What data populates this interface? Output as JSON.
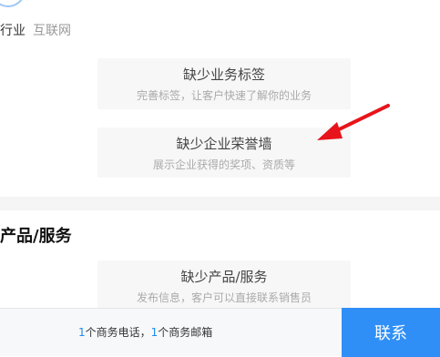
{
  "company": {
    "industry_label": "行业",
    "industry_value": "互联网"
  },
  "empty_states": {
    "tags": {
      "title": "缺少业务标签",
      "subtitle": "完善标签，让客户快速了解你的业务"
    },
    "honor": {
      "title": "缺少企业荣誉墙",
      "subtitle": "展示企业获得的奖项、资质等"
    },
    "product": {
      "title": "缺少产品/服务",
      "subtitle": "发布信息，客户可以直接联系销售员"
    }
  },
  "sections": {
    "products_title": "产品/服务"
  },
  "contact_bar": {
    "phone_count": "1",
    "phone_text": "个商务电话，",
    "email_count": "1",
    "email_text": "个商务邮箱",
    "button_label": "联系"
  },
  "colors": {
    "accent": "#2f8ff7",
    "annotation_arrow": "#e8141b"
  }
}
